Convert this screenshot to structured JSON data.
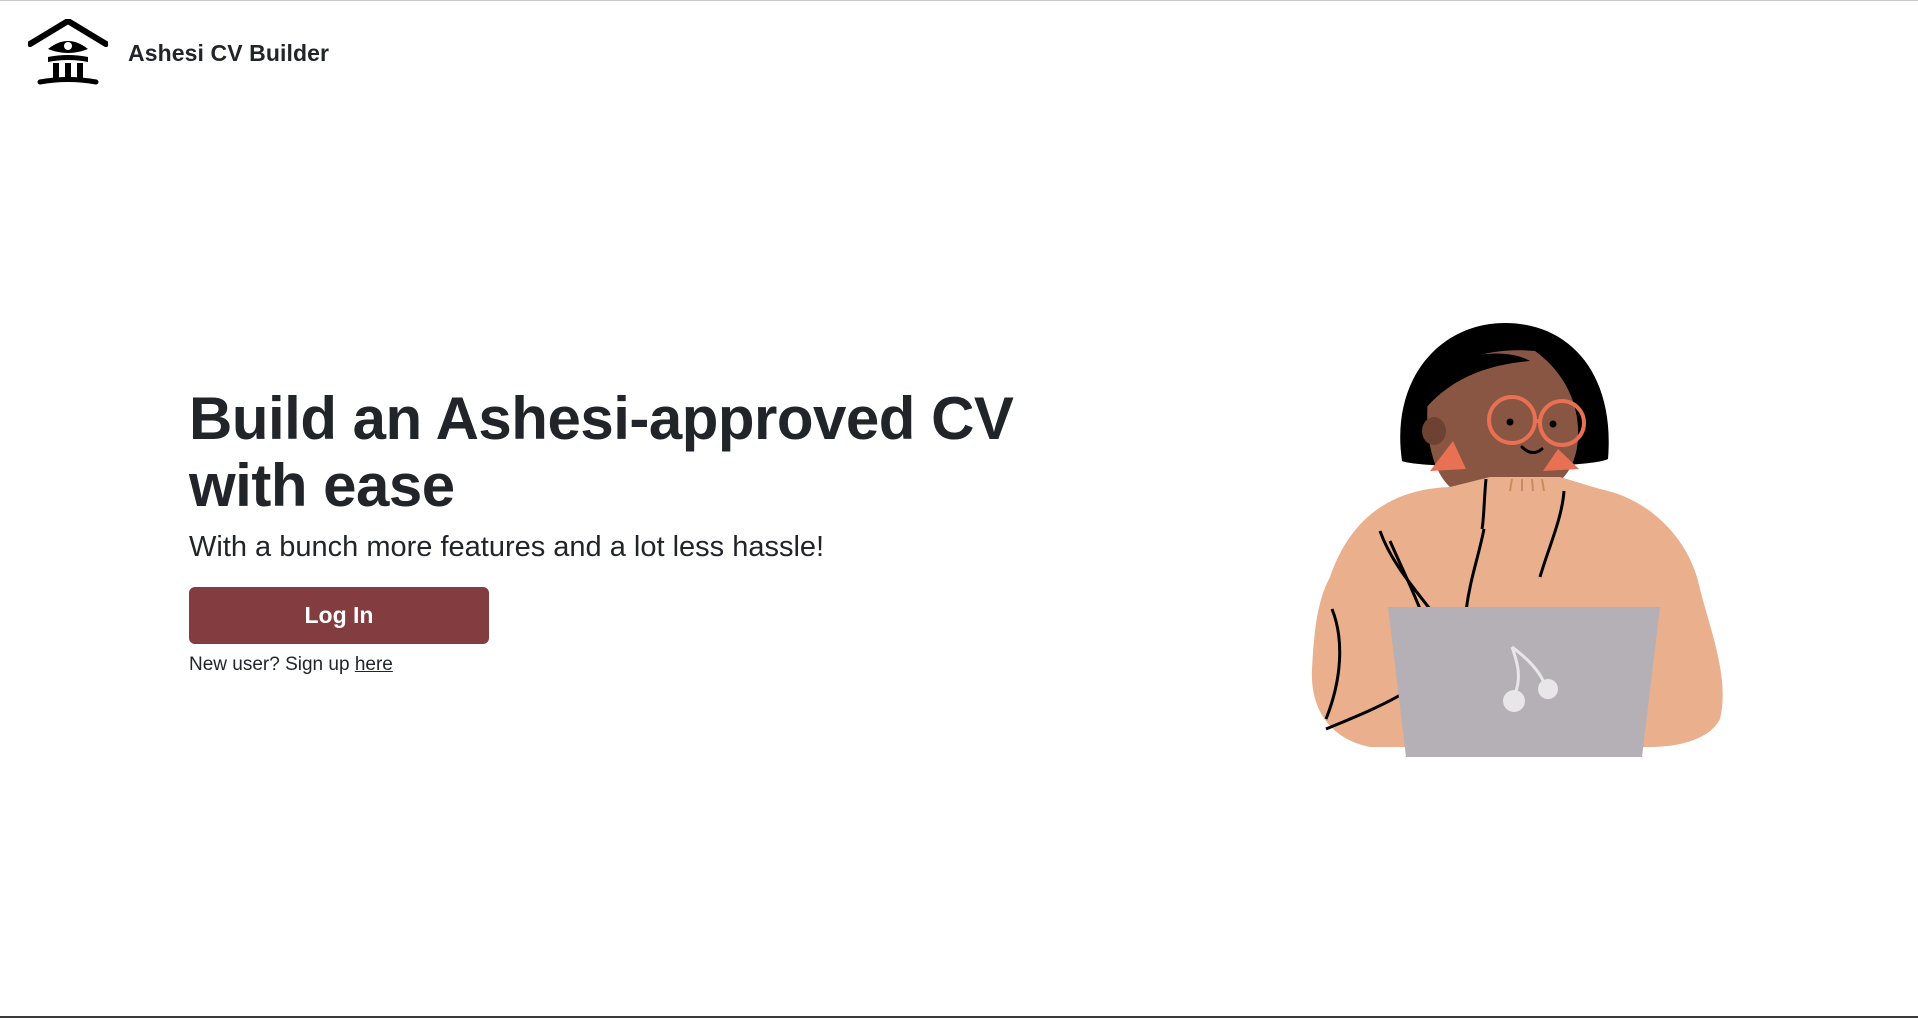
{
  "navbar": {
    "brand_name": "Ashesi CV Builder",
    "logo_icon": "ashesi-building-logo"
  },
  "hero": {
    "title_line1": "Build an Ashesi-approved CV",
    "title_line2": "with ease",
    "subtitle": "With a bunch more features and a lot less hassle!",
    "login_label": "Log In",
    "signup_prompt": "New user? Sign up ",
    "signup_link_label": "here"
  },
  "illustration": {
    "icon": "woman-with-laptop-illustration"
  },
  "colors": {
    "primary_button": "#833c3f",
    "text": "#212529",
    "background": "#ffffff"
  }
}
